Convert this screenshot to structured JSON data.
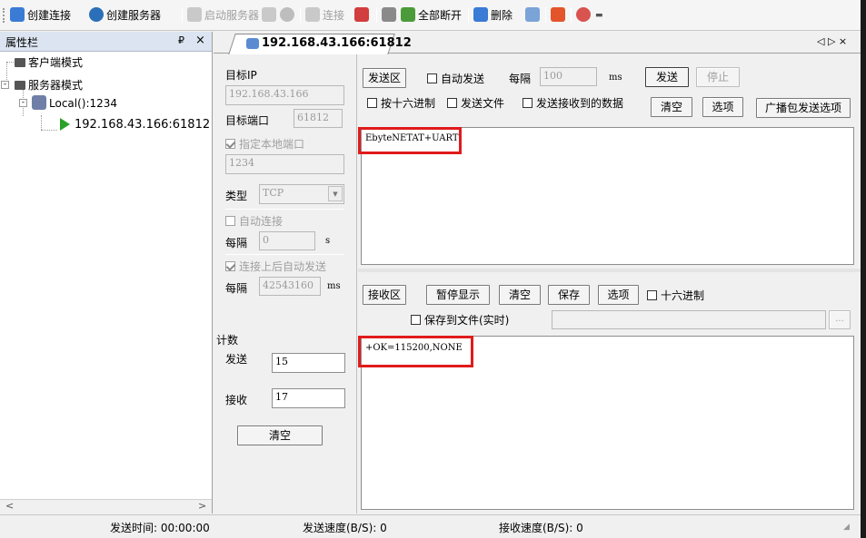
{
  "toolbar": {
    "create_connection": "创建连接",
    "create_server": "创建服务器",
    "start_server": "启动服务器",
    "connect": "连接",
    "disconnect_all": "全部断开",
    "delete": "删除"
  },
  "sidebar": {
    "title": "属性栏",
    "pin": "₽",
    "close": "×",
    "client_mode": "客户端模式",
    "server_mode": "服务器模式",
    "local": "Local():1234",
    "conn": "192.168.43.166:61812"
  },
  "tab": {
    "title": "192.168.43.166:61812",
    "nav": "◁ ▷ ×"
  },
  "settings": {
    "target_ip_label": "目标IP",
    "target_ip": "192.168.43.166",
    "target_port_label": "目标端口",
    "target_port": "61812",
    "local_port_label": "指定本地端口",
    "local_port": "1234",
    "type_label": "类型",
    "type_value": "TCP",
    "auto_connect_label": "自动连接",
    "interval_label": "每隔",
    "interval_value": "0",
    "interval_unit": "s",
    "auto_send_label": "连接上后自动发送",
    "interval2_label": "每隔",
    "interval2_value": "42543160",
    "interval2_unit": "ms"
  },
  "counter": {
    "title": "计数",
    "send_label": "发送",
    "send_value": "15",
    "recv_label": "接收",
    "recv_value": "17",
    "clear": "清空"
  },
  "send": {
    "area_label": "发送区",
    "auto_send": "自动发送",
    "every": "每隔",
    "interval": "100",
    "unit": "ms",
    "send_btn": "发送",
    "stop_btn": "停止",
    "hex": "按十六进制",
    "send_file": "发送文件",
    "send_received": "发送接收到的数据",
    "clear_btn": "清空",
    "options_btn": "选项",
    "broadcast_btn": "广播包发送选项",
    "content": "EbyteNETAT+UART"
  },
  "receive": {
    "area_label": "接收区",
    "pause_btn": "暂停显示",
    "clear_btn": "清空",
    "save_btn": "保存",
    "options_btn": "选项",
    "hex": "十六进制",
    "save_to_file": "保存到文件(实时)",
    "browse": "...",
    "content": "+OK=115200,NONE"
  },
  "status": {
    "send_time": "发送时间: 00:00:00",
    "send_speed": "发送速度(B/S): 0",
    "recv_speed": "接收速度(B/S): 0"
  },
  "colors": {
    "highlight_box": "#e01b1b",
    "play_icon": "#2aa12a"
  }
}
